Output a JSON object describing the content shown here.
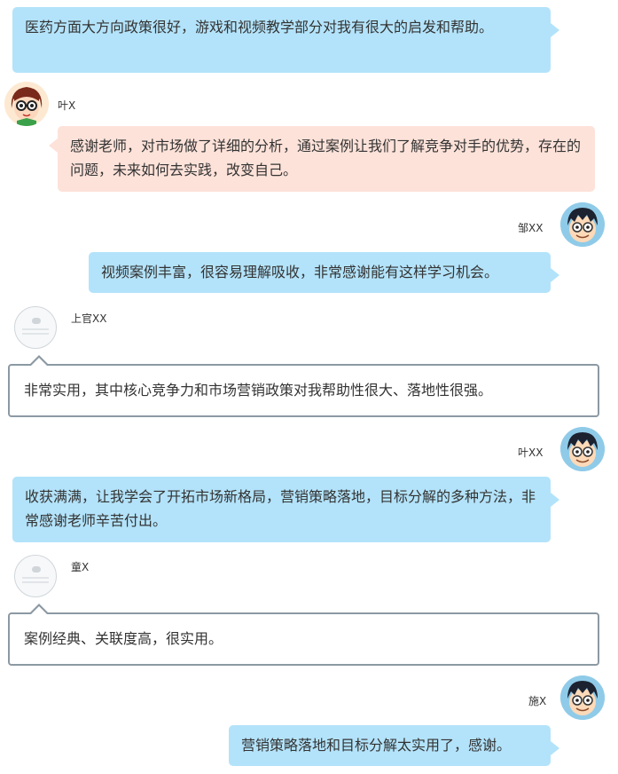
{
  "messages": [
    {
      "text": "医药方面大方向政策很好，游戏和视频教学部分对我有很大的启发和帮助。"
    },
    {
      "name": "叶X",
      "text": "感谢老师，对市场做了详细的分析，通过案例让我们了解竞争对手的优势，存在的问题，未来如何去实践，改变自己。"
    },
    {
      "name": "邹XX",
      "text": "视频案例丰富，很容易理解吸收，非常感谢能有这样学习机会。"
    },
    {
      "name": "上官XX",
      "text": "非常实用，其中核心竞争力和市场营销政策对我帮助性很大、落地性很强。"
    },
    {
      "name": "叶XX",
      "text": "收获满满，让我学会了开拓市场新格局，营销策略落地，目标分解的多种方法，非常感谢老师辛苦付出。"
    },
    {
      "name": "童X",
      "text": "案例经典、关联度高，很实用。"
    },
    {
      "name": "施X",
      "text": "营销策略落地和目标分解太实用了，感谢。"
    }
  ],
  "colors": {
    "blue_bubble": "#b3e3fa",
    "pink_bubble": "#fde2d9",
    "outline_bubble_border": "#8c99a3"
  },
  "icons": {
    "boy": "cartoon-boy-avatar-icon",
    "girl": "cartoon-girl-avatar-icon",
    "placeholder": "placeholder-avatar-icon"
  }
}
